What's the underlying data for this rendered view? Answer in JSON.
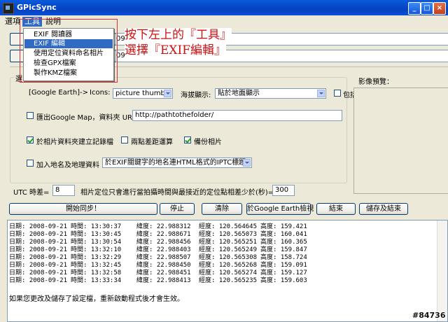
{
  "window": {
    "title": "GPicSync"
  },
  "menu": {
    "items": [
      "選項",
      "工具",
      "說明"
    ],
    "tools_items": [
      "EXIF 閱讀器",
      "EXIF 編輯",
      "使用定位資料命名相片",
      "檢查GPX檔案",
      "製作KMZ檔案"
    ],
    "selected_index": 1
  },
  "annotation": {
    "line1": "按下左上的『工具』",
    "line2": "選擇『EXIF編輯』"
  },
  "paths": {
    "partial1": "09",
    "partial2": "09"
  },
  "options": {
    "group_label": "選",
    "google_earth_label": "[Google Earth]->",
    "icons_label": "Icons:",
    "icons_value": "picture thumb",
    "display_label": "海拔顯示:",
    "display_value": "貼於地面顯示",
    "include_label": "包括",
    "export_gmap_label": "匯出Google Map，資料夾 URL=",
    "export_gmap_url": "http://pathtothefolder/",
    "export_gmap_checked": false,
    "create_log_label": "於相片資料夾建立記錄檔",
    "create_log_checked": true,
    "interpolate_label": "兩點差距運算",
    "interpolate_checked": false,
    "backup_label": "備份相片",
    "backup_checked": true,
    "geonames_label": "加入地名及地理資料",
    "geonames_checked": false,
    "geonames_value": "於EXIF關鍵字的地名連HTML格式的IPTC標題"
  },
  "preview_label": "影像預覽：",
  "utc": {
    "label": "UTC 時差=",
    "value": "8"
  },
  "tolerance": {
    "label": "相片定位只會進行當拍攝時間與最接近的定位點相差少於(秒)=",
    "value": "300"
  },
  "buttons": {
    "start": "開始同步！",
    "stop": "停止",
    "clear": "清除",
    "google_earth": "於Google Earth檢視",
    "end": "結束",
    "save_end": "儲存及結束"
  },
  "log": {
    "rows": [
      {
        "date": "日期: 2008-09-21",
        "time": "時間: 13:30:37",
        "lat": "緯度: 22.988312",
        "lon": "經度: 120.564645",
        "alt": "高度: 159.421"
      },
      {
        "date": "日期: 2008-09-21",
        "time": "時間: 13:30:45",
        "lat": "緯度: 22.988671",
        "lon": "經度: 120.565073",
        "alt": "高度: 160.041"
      },
      {
        "date": "日期: 2008-09-21",
        "time": "時間: 13:30:54",
        "lat": "緯度: 22.988456",
        "lon": "經度: 120.565251",
        "alt": "高度: 160.365"
      },
      {
        "date": "日期: 2008-09-21",
        "time": "時間: 13:32:10",
        "lat": "緯度: 22.988403",
        "lon": "經度: 120.565249",
        "alt": "高度: 159.847"
      },
      {
        "date": "日期: 2008-09-21",
        "time": "時間: 13:32:29",
        "lat": "緯度: 22.988507",
        "lon": "經度: 120.565308",
        "alt": "高度: 158.724"
      },
      {
        "date": "日期: 2008-09-21",
        "time": "時間: 13:32:45",
        "lat": "緯度: 22.988450",
        "lon": "經度: 120.565268",
        "alt": "高度: 159.091"
      },
      {
        "date": "日期: 2008-09-21",
        "time": "時間: 13:32:58",
        "lat": "緯度: 22.988451",
        "lon": "經度: 120.565274",
        "alt": "高度: 159.127"
      },
      {
        "date": "日期: 2008-09-21",
        "time": "時間: 13:33:34",
        "lat": "緯度: 22.988413",
        "lon": "經度: 120.565235",
        "alt": "高度: 159.603"
      }
    ],
    "note": "如果您更改及儲存了設定檔，重新啟動程式後才會生效。"
  },
  "watermark": "#84736"
}
